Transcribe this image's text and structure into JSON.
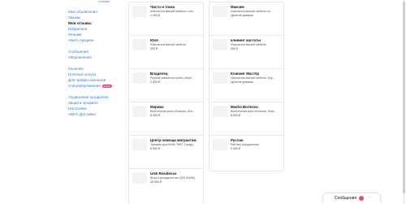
{
  "sidebar": {
    "top_link": "отзывов",
    "items": [
      {
        "label": "Мои объявления",
        "active": false
      },
      {
        "label": "Заказы",
        "active": false
      },
      {
        "label": "Мои отзывы",
        "active": true
      },
      {
        "label": "Избранное",
        "active": false
      },
      {
        "label": "Резюме",
        "active": false
      },
      {
        "label": "Авито Аукцион",
        "active": false
      },
      {
        "label": "Сообщения",
        "active": false
      },
      {
        "label": "Уведомления",
        "active": false
      },
      {
        "label": "Кошелёк",
        "active": false
      },
      {
        "label": "Платные услуги",
        "active": false
      },
      {
        "label": "Для профессионалов",
        "active": false
      },
      {
        "label": "Спецпредложения",
        "active": false,
        "badge": "Новое"
      },
      {
        "label": "Управление профилем",
        "active": false
      },
      {
        "label": "Защита профиля",
        "active": false
      },
      {
        "label": "Настройки",
        "active": false
      },
      {
        "label": "Авито Доставка",
        "active": false
      }
    ]
  },
  "cards": [
    {
      "title": "Чисто и точка",
      "desc": "Химчистка мягкой мебели с нат...",
      "price": "1 000 ₽"
    },
    {
      "title": "Максим",
      "desc": "Химчистка мягкой мебели на ...",
      "price": "Цена не указана"
    },
    {
      "title": "Юля",
      "desc": "Химчистка мягкой мебели",
      "price": "200 ₽"
    },
    {
      "title": "клининг чистоты",
      "desc": "Химчистка мягкой мебели",
      "price": "500 ₽"
    },
    {
      "title": "Владелец",
      "desc": "Ручная химчистка шубы (Экол...",
      "price": "2 000 ₽"
    },
    {
      "title": "Клининг Мастер",
      "desc": "Химчистка мягкой мебели. Клу...",
      "price": "Цена не указана"
    },
    {
      "title": "Марина",
      "desc": "Шенгенская виза Испания, Ита...",
      "price": "8 000 ₽"
    },
    {
      "title": "Masha Borisova",
      "desc": "Шенгенская виза Испания, Итал...",
      "price": "8 000 ₽"
    },
    {
      "title": "Центр помощи мигрантам",
      "desc": "Экзамен для ВНЖ, РВП, Гражд...",
      "price": "5 500 ₽"
    },
    {
      "title": "Руслан",
      "desc": "Рвп вну гражданство",
      "price": "9 000 ₽"
    },
    {
      "title": "UAE Residence",
      "desc": "Виза и резидентство ОАЭ (ВНЖ)",
      "price": "25 900 ₽"
    }
  ],
  "messages": {
    "label": "Сообщения",
    "dots": "···"
  }
}
